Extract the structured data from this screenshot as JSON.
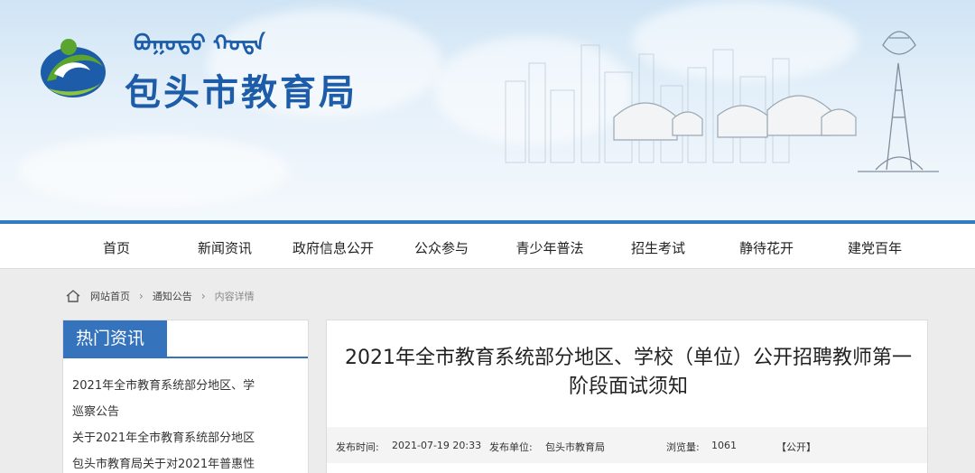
{
  "header": {
    "mongolian_title": "ᠪᠣᠭᠣᠲᠣ ᠬᠣᠲᠠ",
    "site_title": "包头市教育局"
  },
  "nav": {
    "items": [
      "首页",
      "新闻资讯",
      "政府信息公开",
      "公众参与",
      "青少年普法",
      "招生考试",
      "静待花开",
      "建党百年"
    ]
  },
  "breadcrumb": {
    "items": [
      "网站首页",
      "通知公告",
      "内容详情"
    ]
  },
  "sidebar": {
    "heading": "热门资讯",
    "items": [
      "2021年全市教育系统部分地区、学",
      "巡察公告",
      "关于2021年全市教育系统部分地区",
      "包头市教育局关于对2021年普惠性"
    ]
  },
  "article": {
    "title": "2021年全市教育系统部分地区、学校（单位）公开招聘教师第一阶段面试须知",
    "meta": {
      "publish_time_label": "发布时间:",
      "publish_time": "2021-07-19 20:33",
      "publisher_label": "发布单位:",
      "publisher": "包头市教育局",
      "views_label": "浏览量:",
      "views": "1061",
      "visibility": "【公开】"
    }
  },
  "colors": {
    "brand_blue": "#1d5ca8",
    "accent_blue": "#3574bd",
    "logo_green": "#5aa52f"
  }
}
